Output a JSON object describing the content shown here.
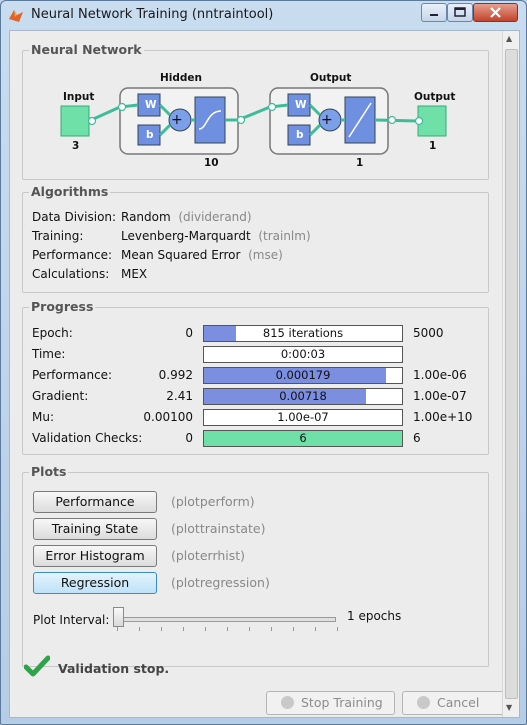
{
  "window": {
    "title": "Neural Network Training (nntraintool)"
  },
  "network": {
    "section_label": "Neural Network",
    "input_label": "Input",
    "input_count": "3",
    "hidden_label": "Hidden",
    "hidden_count": "10",
    "output_layer_label": "Output",
    "output_layer_count": "1",
    "output_label": "Output",
    "output_count": "1",
    "weight_label": "W",
    "bias_label": "b"
  },
  "algorithms": {
    "section_label": "Algorithms",
    "rows": [
      {
        "label": "Data Division:",
        "value": "Random",
        "fn": "(dividerand)"
      },
      {
        "label": "Training:",
        "value": "Levenberg-Marquardt",
        "fn": "(trainlm)"
      },
      {
        "label": "Performance:",
        "value": "Mean Squared Error",
        "fn": "(mse)"
      },
      {
        "label": "Calculations:",
        "value": "MEX",
        "fn": ""
      }
    ]
  },
  "progress": {
    "section_label": "Progress",
    "rows": [
      {
        "label": "Epoch:",
        "min": "0",
        "bar_text": "815 iterations",
        "max": "5000",
        "fill": 0.163,
        "color": "#7b8ee0"
      },
      {
        "label": "Time:",
        "min": "",
        "bar_text": "0:00:03",
        "max": "",
        "fill": 0,
        "color": "#7b8ee0"
      },
      {
        "label": "Performance:",
        "min": "0.992",
        "bar_text": "0.000179",
        "max": "1.00e-06",
        "fill": 0.92,
        "color": "#7b8ee0"
      },
      {
        "label": "Gradient:",
        "min": "2.41",
        "bar_text": "0.00718",
        "max": "1.00e-07",
        "fill": 0.82,
        "color": "#7b8ee0"
      },
      {
        "label": "Mu:",
        "min": "0.00100",
        "bar_text": "1.00e-07",
        "max": "1.00e+10",
        "fill": 0,
        "color": "#7b8ee0"
      },
      {
        "label": "Validation Checks:",
        "min": "0",
        "bar_text": "6",
        "max": "6",
        "fill": 1.0,
        "color": "#6fe0a8"
      }
    ]
  },
  "plots": {
    "section_label": "Plots",
    "buttons": [
      {
        "label": "Performance",
        "fn": "(plotperform)",
        "active": false
      },
      {
        "label": "Training State",
        "fn": "(plottrainstate)",
        "active": false
      },
      {
        "label": "Error Histogram",
        "fn": "(ploterrhist)",
        "active": false
      },
      {
        "label": "Regression",
        "fn": "(plotregression)",
        "active": true
      }
    ],
    "interval_label": "Plot Interval:",
    "interval_value": "1 epochs",
    "slider_fraction": 0
  },
  "status": {
    "text": "Validation stop.",
    "icon": "check-icon"
  },
  "footer": {
    "stop_label": "Stop Training",
    "cancel_label": "Cancel"
  },
  "colors": {
    "accent_blue": "#7b8ee0",
    "accent_green": "#6fe0a8",
    "node_green": "#6fe0a8"
  }
}
